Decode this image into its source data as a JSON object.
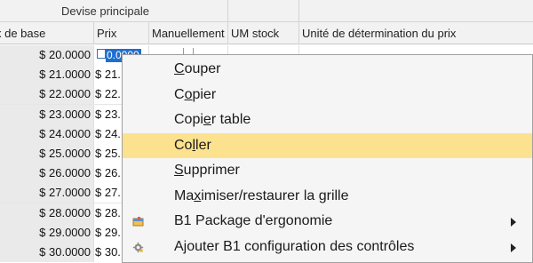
{
  "grid": {
    "group_header": "Devise principale",
    "columns": [
      "x de base",
      "Prix",
      "Manuellement",
      "UM stock",
      "Unité de détermination du prix"
    ],
    "rows": [
      {
        "base": "$ 20.0000",
        "prix": "0.0000",
        "selected": true
      },
      {
        "base": "$ 21.0000",
        "prix": "$ 21."
      },
      {
        "base": "$ 22.0000",
        "prix": "$ 22."
      },
      {
        "base": "$ 23.0000",
        "prix": "$ 23."
      },
      {
        "base": "$ 24.0000",
        "prix": "$ 24."
      },
      {
        "base": "$ 25.0000",
        "prix": "$ 25."
      },
      {
        "base": "$ 26.0000",
        "prix": "$ 26."
      },
      {
        "base": "$ 27.0000",
        "prix": "$ 27."
      },
      {
        "base": "$ 28.0000",
        "prix": "$ 28."
      },
      {
        "base": "$ 29.0000",
        "prix": "$ 29."
      },
      {
        "base": "$ 30.0000",
        "prix": "$ 30."
      }
    ]
  },
  "context_menu": {
    "items": [
      {
        "label_pre": "",
        "accel": "C",
        "label_post": "ouper"
      },
      {
        "label_pre": "C",
        "accel": "o",
        "label_post": "pier"
      },
      {
        "label_pre": "Copi",
        "accel": "e",
        "label_post": "r table"
      },
      {
        "label_pre": "Co",
        "accel": "l",
        "label_post": "ler",
        "highlighted": true
      },
      {
        "label_pre": "",
        "accel": "S",
        "label_post": "upprimer"
      },
      {
        "label_pre": "Ma",
        "accel": "x",
        "label_post": "imiser/restaurer la grille"
      },
      {
        "label_pre": "",
        "accel": "",
        "label_post": "B1 Package d'ergonomie",
        "icon": "package-icon",
        "submenu": true
      },
      {
        "label_pre": "",
        "accel": "",
        "label_post": "Ajouter B1 configuration des contrôles",
        "icon": "gear-icon",
        "submenu": true
      }
    ],
    "highlight_color": "#fce28e"
  }
}
